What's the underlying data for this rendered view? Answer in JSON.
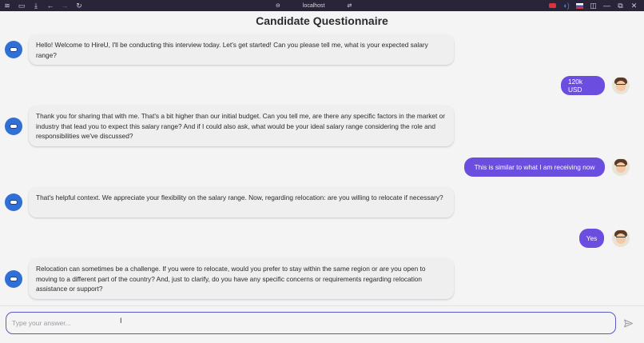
{
  "browser": {
    "url": "localhost"
  },
  "page": {
    "title": "Candidate Questionnaire"
  },
  "messages": [
    {
      "role": "bot",
      "text": "Hello! Welcome to HireU, I'll be conducting this interview today. Let's get started! Can you please tell me, what is your expected salary range?"
    },
    {
      "role": "user",
      "text": "120k USD"
    },
    {
      "role": "bot",
      "text": "Thank you for sharing that with me. That's a bit higher than our initial budget. Can you tell me, are there any specific factors in the market or industry that lead you to expect this salary range? And if I could also ask, what would be your ideal salary range considering the role and responsibilities we've discussed?"
    },
    {
      "role": "user",
      "text": "This is similar to what I am receiving now"
    },
    {
      "role": "bot",
      "text": "That's helpful context. We appreciate your flexibility on the salary range. Now, regarding relocation: are you willing to relocate if necessary?"
    },
    {
      "role": "user",
      "text": "Yes"
    },
    {
      "role": "bot",
      "text": "Relocation can sometimes be a challenge. If you were to relocate, would you prefer to stay within the same region or are you open to moving to a different part of the country? And, just to clarify, do you have any specific concerns or requirements regarding relocation assistance or support?"
    }
  ],
  "composer": {
    "placeholder": "Type your answer..."
  },
  "colors": {
    "user_bubble": "#6b4de0",
    "bot_bubble": "#efefef",
    "input_border": "#5f58c7",
    "bot_avatar": "#2f6fd6"
  }
}
